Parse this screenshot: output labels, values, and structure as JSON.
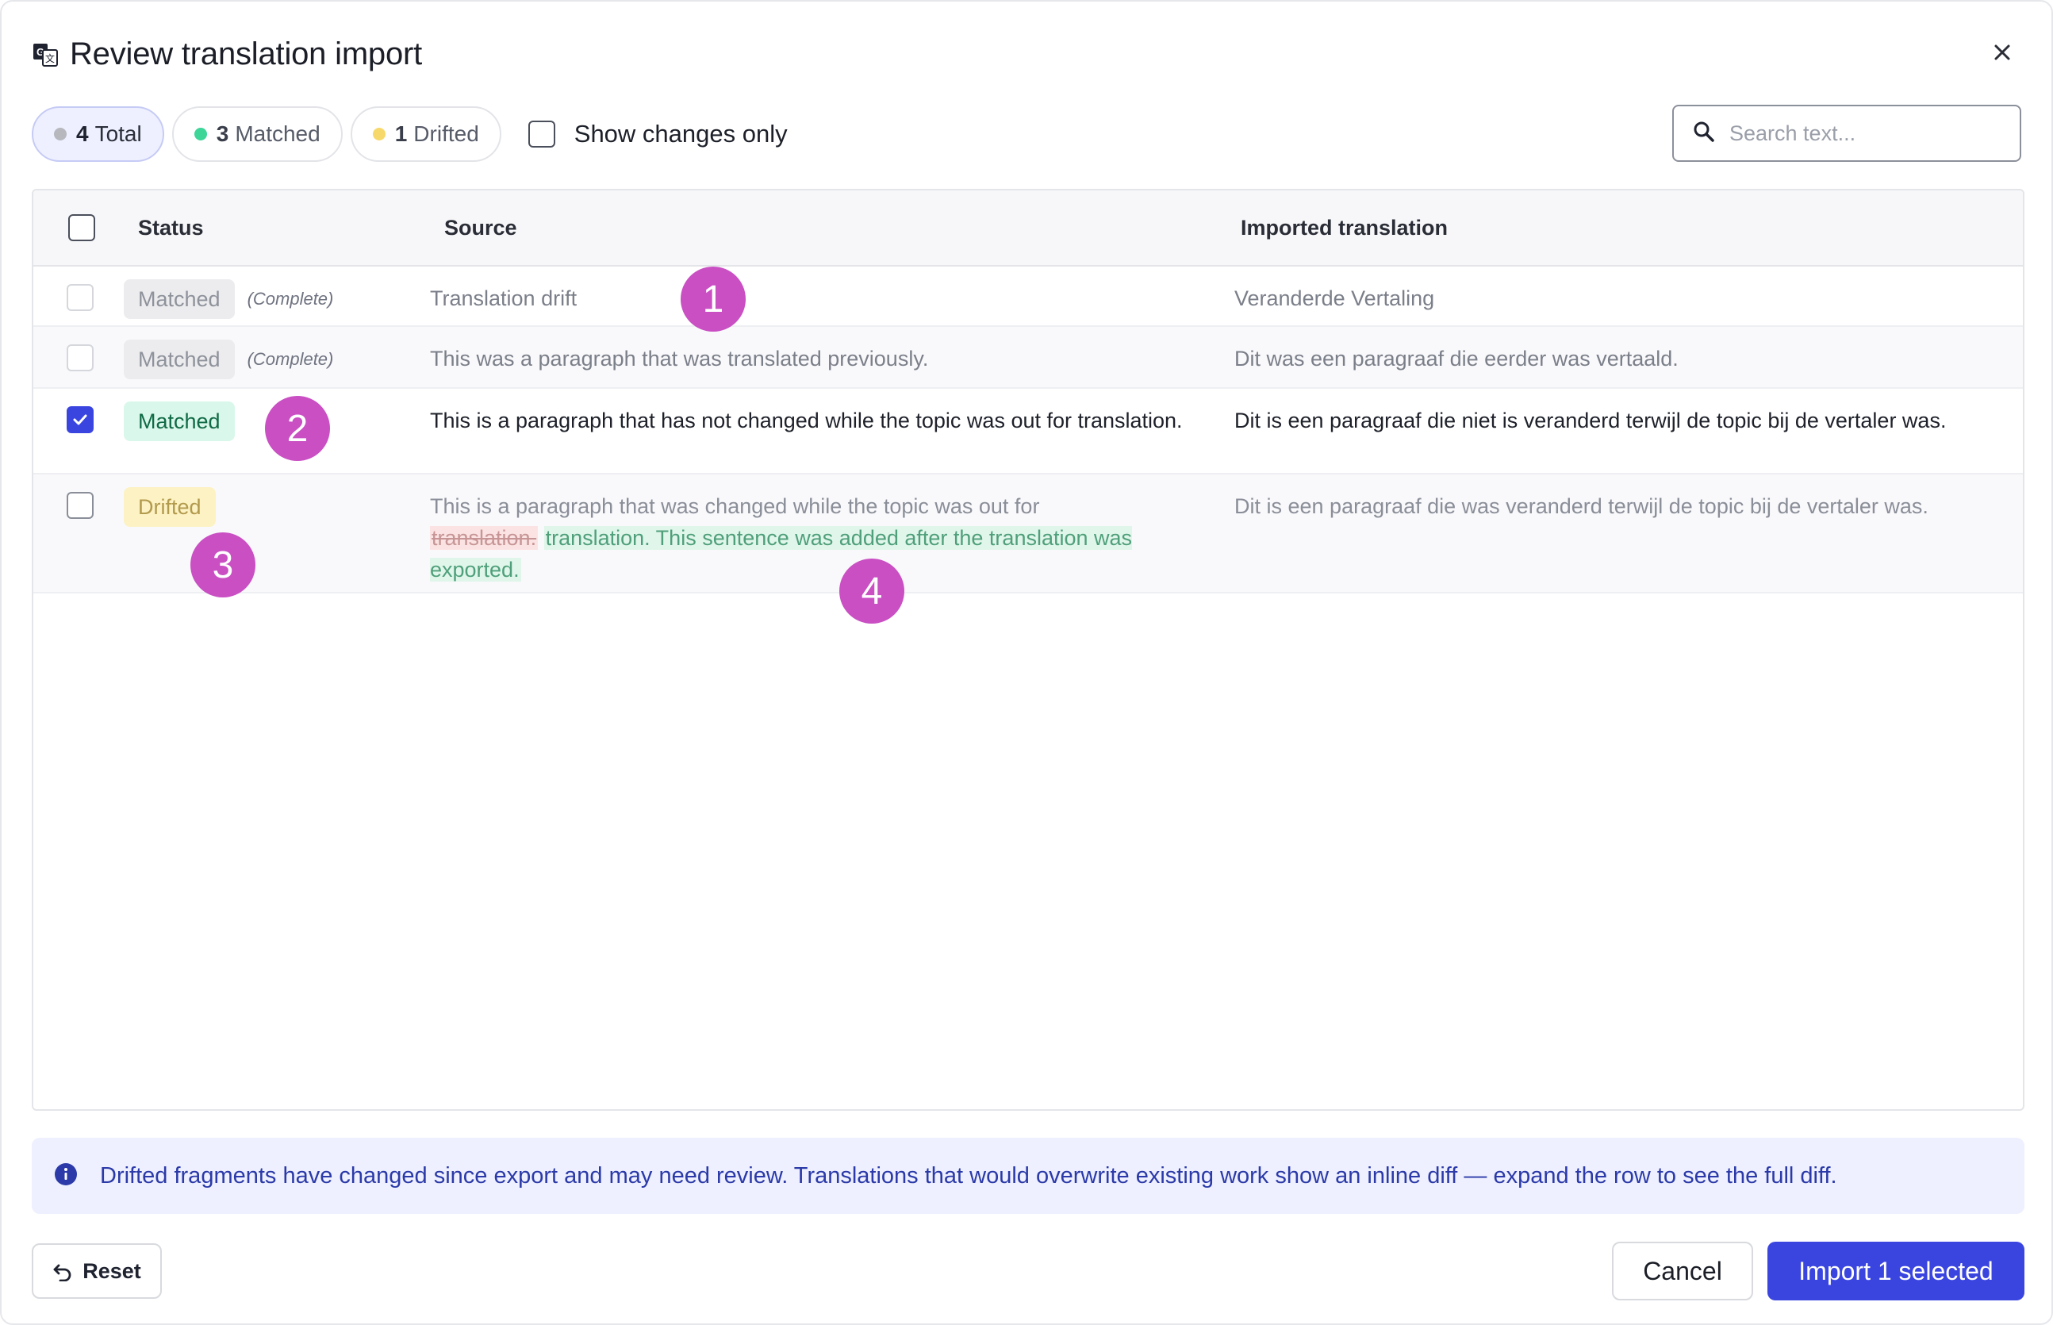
{
  "dialog": {
    "title": "Review translation import",
    "close_label": "×"
  },
  "filters": {
    "total": {
      "count": "4",
      "label": "Total",
      "color": "#b6b8be"
    },
    "matched": {
      "count": "3",
      "label": "Matched",
      "color": "#3dd598"
    },
    "drifted": {
      "count": "1",
      "label": "Drifted",
      "color": "#f7d96b"
    },
    "show_changes_label": "Show changes only",
    "show_changes_checked": false
  },
  "search": {
    "placeholder": "Search text...",
    "value": ""
  },
  "table": {
    "headers": {
      "status": "Status",
      "source": "Source",
      "imported": "Imported translation"
    },
    "rows": [
      {
        "checked": false,
        "status": "Matched",
        "tag": "(Complete)",
        "source": "Translation drift",
        "imported": "Veranderde Vertaling"
      },
      {
        "checked": false,
        "status": "Matched",
        "tag": "(Complete)",
        "source": "This was a paragraph that was translated previously.",
        "imported": "Dit was een paragraaf die eerder was vertaald."
      },
      {
        "checked": true,
        "status": "Matched",
        "tag": "",
        "source": "This is a paragraph that has not changed while the topic was out for translation.",
        "imported": "Dit is een paragraaf die niet is veranderd terwijl de topic bij de vertaler was."
      },
      {
        "checked": false,
        "status": "Drifted",
        "tag": "",
        "source_prefix": "This is a paragraph that was changed while the topic was out for",
        "source_deleted": "translation.",
        "source_inserted": "translation. This sentence was added after the translation was exported.",
        "imported": "Dit is een paragraaf die was veranderd terwijl de topic bij de vertaler was."
      }
    ]
  },
  "markers": [
    "1",
    "2",
    "3",
    "4"
  ],
  "info": {
    "text": "Drifted fragments have changed since export and may need review. Translations that would overwrite existing work show an inline diff — expand the row to see the full diff."
  },
  "footer": {
    "reset_label": "Reset",
    "cancel_label": "Cancel",
    "import_label": "Import 1 selected"
  },
  "colors": {
    "accent": "#3a45e0",
    "marker": "#c94fc3",
    "matched_badge_bg": "#d9f7ea",
    "drifted_badge_bg": "#fdf2c3"
  }
}
